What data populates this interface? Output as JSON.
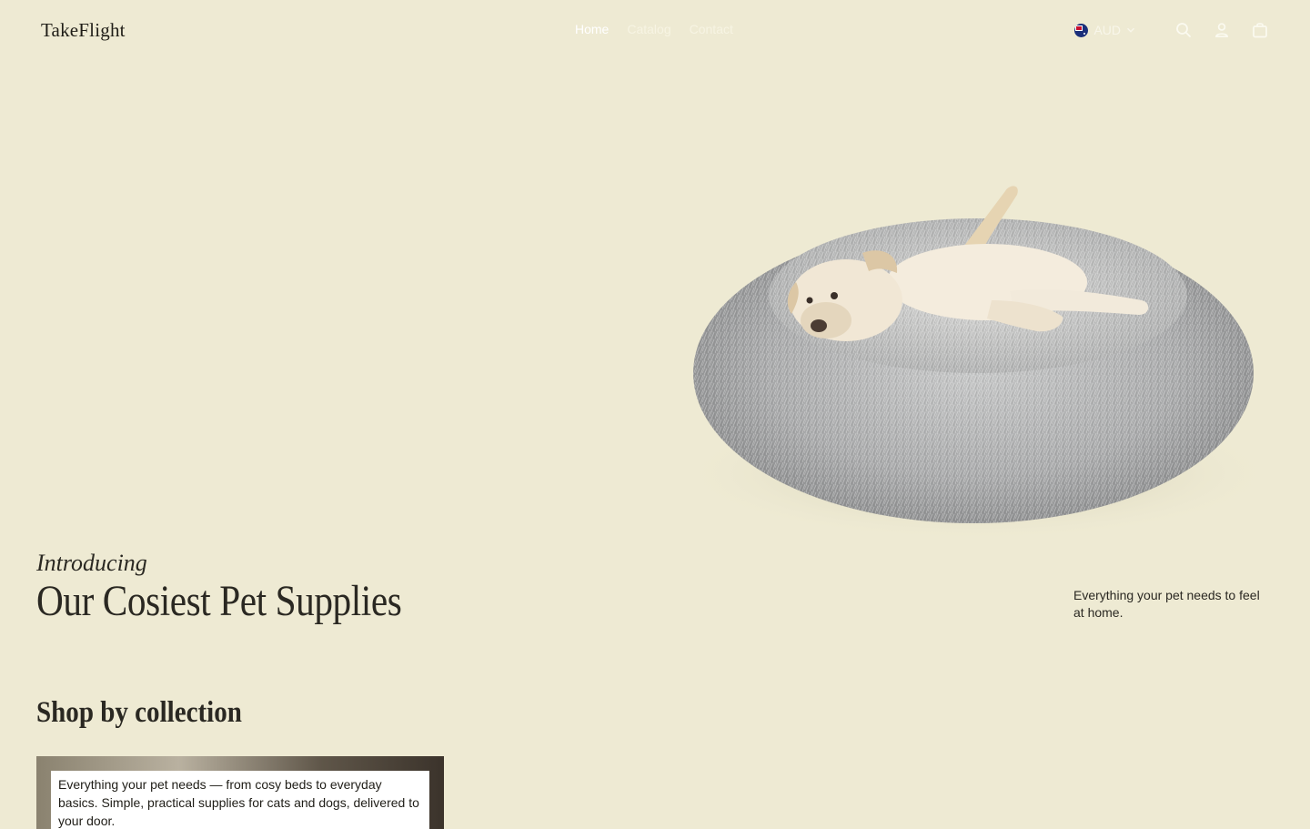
{
  "header": {
    "logo": "TakeFlight",
    "nav": [
      {
        "label": "Home"
      },
      {
        "label": "Catalog"
      },
      {
        "label": "Contact"
      }
    ],
    "currency": "AUD",
    "icons": [
      "au-flag-icon",
      "chevron-down-icon",
      "search-icon",
      "account-icon",
      "cart-icon"
    ]
  },
  "hero": {
    "kicker": "Introducing",
    "title": "Our Cosiest Pet Supplies",
    "copy": "Everything your pet needs to feel at home.",
    "image_alt": "dog lying in a round grey fluffy pet bed"
  },
  "collections": {
    "heading": "Shop by collection",
    "cards": [
      {
        "caption": "Everything your pet needs — from cosy beds to everyday basics. Simple, practical supplies for cats and dogs, delivered to your door."
      }
    ]
  },
  "colors": {
    "background": "#eeead3",
    "text": "#1f1d17"
  }
}
